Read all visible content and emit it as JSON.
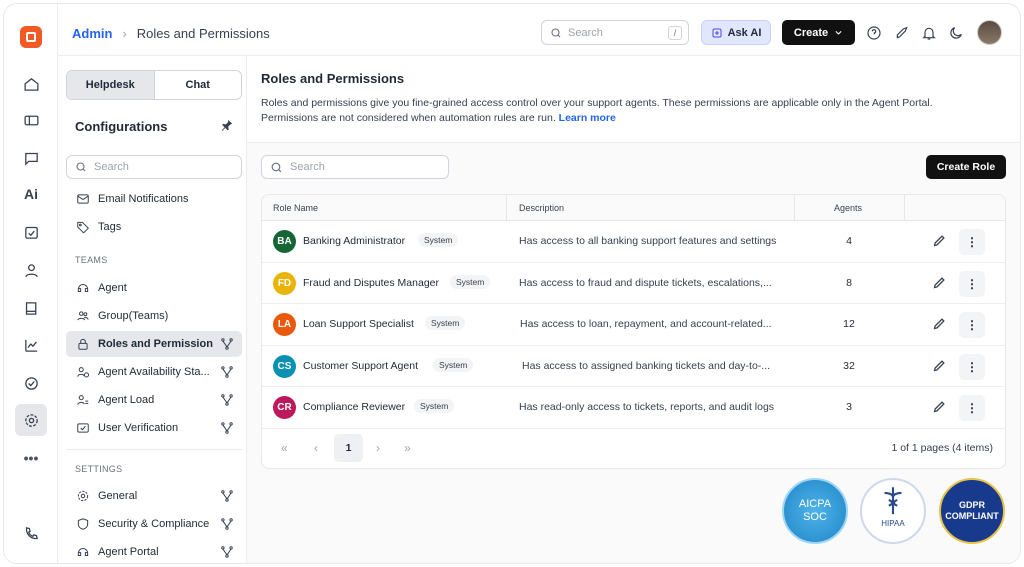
{
  "topbar": {
    "breadcrumb_root": "Admin",
    "breadcrumb_separator": "›",
    "breadcrumb_current": "Roles and Permissions",
    "search_placeholder": "Search",
    "search_shortcut": "/",
    "ask_ai_label": "Ask AI",
    "create_label": "Create"
  },
  "sidebar": {
    "tab_helpdesk": "Helpdesk",
    "tab_chat": "Chat",
    "title": "Configurations",
    "search_placeholder": "Search",
    "items_top": [
      {
        "label": "Email Notifications",
        "icon": "mail-settings-icon"
      },
      {
        "label": "Tags",
        "icon": "tag-icon"
      }
    ],
    "teams_heading": "TEAMS",
    "teams": [
      {
        "label": "Agent",
        "icon": "headset-icon"
      },
      {
        "label": "Group(Teams)",
        "icon": "group-icon"
      },
      {
        "label": "Roles and Permission",
        "icon": "lock-icon"
      },
      {
        "label": "Agent Availability Sta...",
        "icon": "user-clock-icon"
      },
      {
        "label": "Agent Load",
        "icon": "user-load-icon"
      },
      {
        "label": "User Verification",
        "icon": "verify-icon"
      }
    ],
    "settings_heading": "SETTINGS",
    "settings": [
      {
        "label": "General",
        "icon": "gear-icon"
      },
      {
        "label": "Security & Compliance",
        "icon": "shield-icon"
      },
      {
        "label": "Agent Portal",
        "icon": "headset-icon"
      }
    ]
  },
  "main": {
    "title": "Roles and Permissions",
    "description": "Roles and permissions give you fine-grained access control over your support agents. These permissions are applicable only in the Agent Portal. Permissions are not considered when automation rules are run.",
    "learn_more": "Learn more",
    "search_placeholder": "Search",
    "create_role_label": "Create Role",
    "columns": {
      "role_name": "Role Name",
      "description": "Description",
      "agents": "Agents"
    },
    "rows": [
      {
        "initials": "BA",
        "name": "Banking Administrator",
        "tag": "System",
        "description": "Has access to all banking support features and settings",
        "agents": "4",
        "color": "#166534"
      },
      {
        "initials": "FD",
        "name": "Fraud and Disputes Manager",
        "tag": "System",
        "description": "Has access to fraud and dispute tickets, escalations,...",
        "agents": "8",
        "color": "#eab308"
      },
      {
        "initials": "LA",
        "name": "Loan Support Specialist",
        "tag": "System",
        "description": "Has access to loan, repayment, and account-related...",
        "agents": "12",
        "color": "#ea580c"
      },
      {
        "initials": "CS",
        "name": "Customer Support Agent",
        "tag": "System",
        "description": "Has access to assigned banking tickets and day-to-...",
        "agents": "32",
        "color": "#0891b2"
      },
      {
        "initials": "CR",
        "name": "Compliance Reviewer",
        "tag": "System",
        "description": "Has read-only access to tickets, reports, and audit logs",
        "agents": "3",
        "color": "#be185d"
      }
    ],
    "pager": {
      "first": "«",
      "prev": "‹",
      "page": "1",
      "next": "›",
      "last": "»",
      "info": "1 of 1 pages (4 items)"
    },
    "badges": {
      "aicpa_line1": "AICPA",
      "aicpa_line2": "SOC",
      "hipaa": "HIPAA",
      "gdpr_line1": "GDPR",
      "gdpr_line2": "COMPLIANT"
    }
  }
}
